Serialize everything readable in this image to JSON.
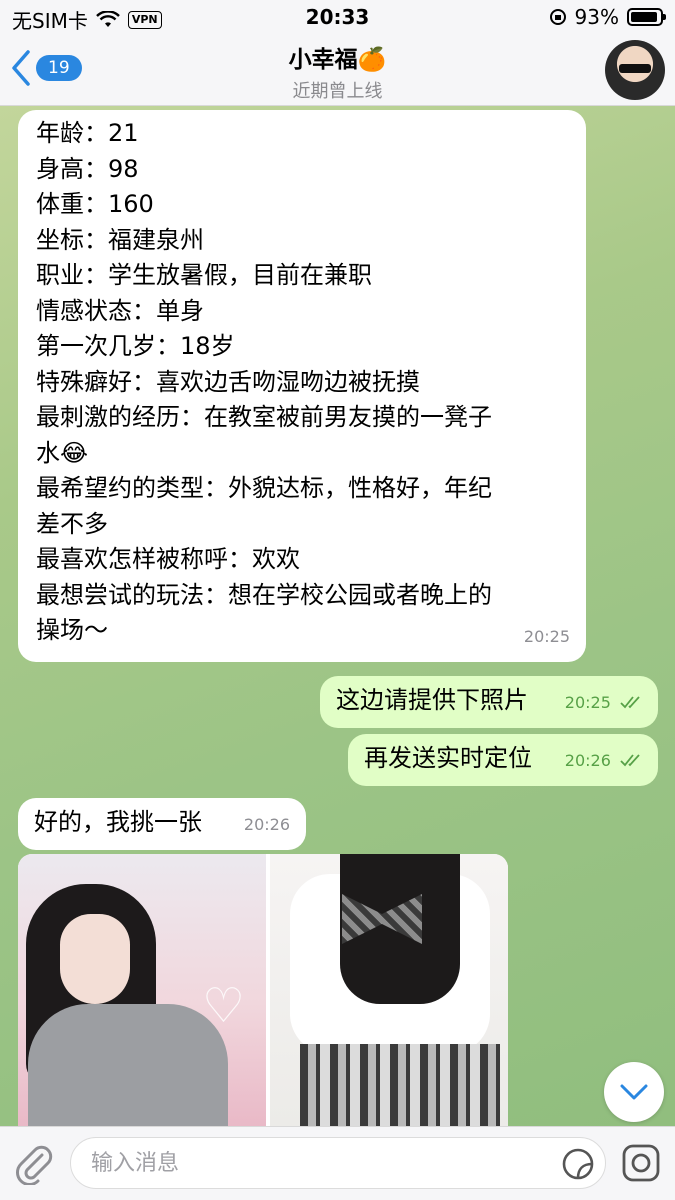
{
  "status_bar": {
    "carrier": "无SIM卡",
    "vpn": "VPN",
    "time": "20:33",
    "battery": "93%",
    "battery_level": 0.93
  },
  "header": {
    "back_badge": "19",
    "contact_name": "小幸福🍊",
    "last_seen": "近期曾上线"
  },
  "messages": [
    {
      "direction": "incoming",
      "lines": [
        "年龄：21",
        "身高：98",
        "体重：160",
        "坐标：福建泉州",
        "职业：学生放暑假，目前在兼职",
        "情感状态：单身",
        "第一次几岁：18岁",
        "特殊癖好：喜欢边舌吻湿吻边被抚摸",
        "最刺激的经历：在教室被前男友摸的一凳子",
        "水😂",
        "最希望约的类型：外貌达标，性格好，年纪",
        "差不多",
        "最喜欢怎样被称呼：欢欢",
        "最想尝试的玩法：想在学校公园或者晚上的",
        "操场～"
      ],
      "time": "20:25"
    },
    {
      "direction": "outgoing",
      "text": "这边请提供下照片",
      "time": "20:25",
      "read": true
    },
    {
      "direction": "outgoing",
      "text": "再发送实时定位",
      "time": "20:26",
      "read": true
    },
    {
      "direction": "incoming",
      "text": "好的，我挑一张",
      "time": "20:26"
    }
  ],
  "input_bar": {
    "placeholder": "输入消息"
  },
  "colors": {
    "accent": "#2a87e0",
    "outgoing_bubble": "#e1fec6",
    "incoming_bubble": "#ffffff",
    "read_check": "#57a147"
  },
  "icons": [
    "wifi-icon",
    "orientation-lock-icon",
    "battery-icon",
    "back-chevron-icon",
    "avatar",
    "paperclip-icon",
    "sticker-icon",
    "camera-icon",
    "scroll-down-icon",
    "double-check-icon"
  ]
}
